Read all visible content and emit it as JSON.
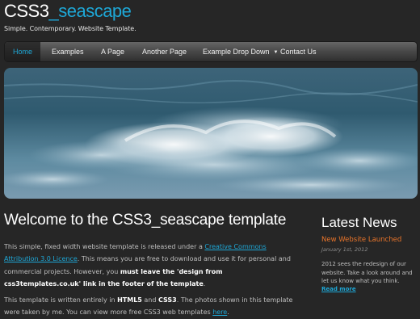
{
  "site": {
    "logo_main": "CSS3",
    "logo_accent": "_seascape",
    "slogan": "Simple. Contemporary. Website Template."
  },
  "menu": {
    "items": [
      {
        "label": "Home",
        "current": true
      },
      {
        "label": "Examples"
      },
      {
        "label": "A Page"
      },
      {
        "label": "Another Page"
      },
      {
        "label": "Example Drop Down",
        "has_dropdown": true
      },
      {
        "label": "Contact Us"
      }
    ],
    "dropdown_icon": "caret-down-icon"
  },
  "banner": {
    "icon": "ocean-wave-image"
  },
  "content": {
    "heading": "Welcome to the CSS3_seascape template",
    "p1_a": "This simple, fixed width website template is released under a ",
    "p1_link": "Creative Commons Attribution 3.0 Licence",
    "p1_b": ". This means you are free to download and use it for personal and commercial projects. However, you ",
    "p1_strong": "must leave the 'design from css3templates.co.uk' link in the footer of the template",
    "p1_c": ".",
    "p2_a": "This template is written entirely in ",
    "p2_html5": "HTML5",
    "p2_and": " and ",
    "p2_css3": "CSS3",
    "p2_b": ". The photos shown in this template were taken by me. You can view more free CSS3 web templates ",
    "p2_link": "here",
    "p2_c": "."
  },
  "sidebar": {
    "heading": "Latest News",
    "news_title": "New Website Launched",
    "news_date": "January 1st, 2012",
    "news_text": "2012 sees the redesign of our website. Take a look around and let us know what you think.",
    "read_more": "Read more"
  },
  "colors": {
    "background": "#262626",
    "accent": "#1ea7d6",
    "news_title": "#e8742a"
  }
}
